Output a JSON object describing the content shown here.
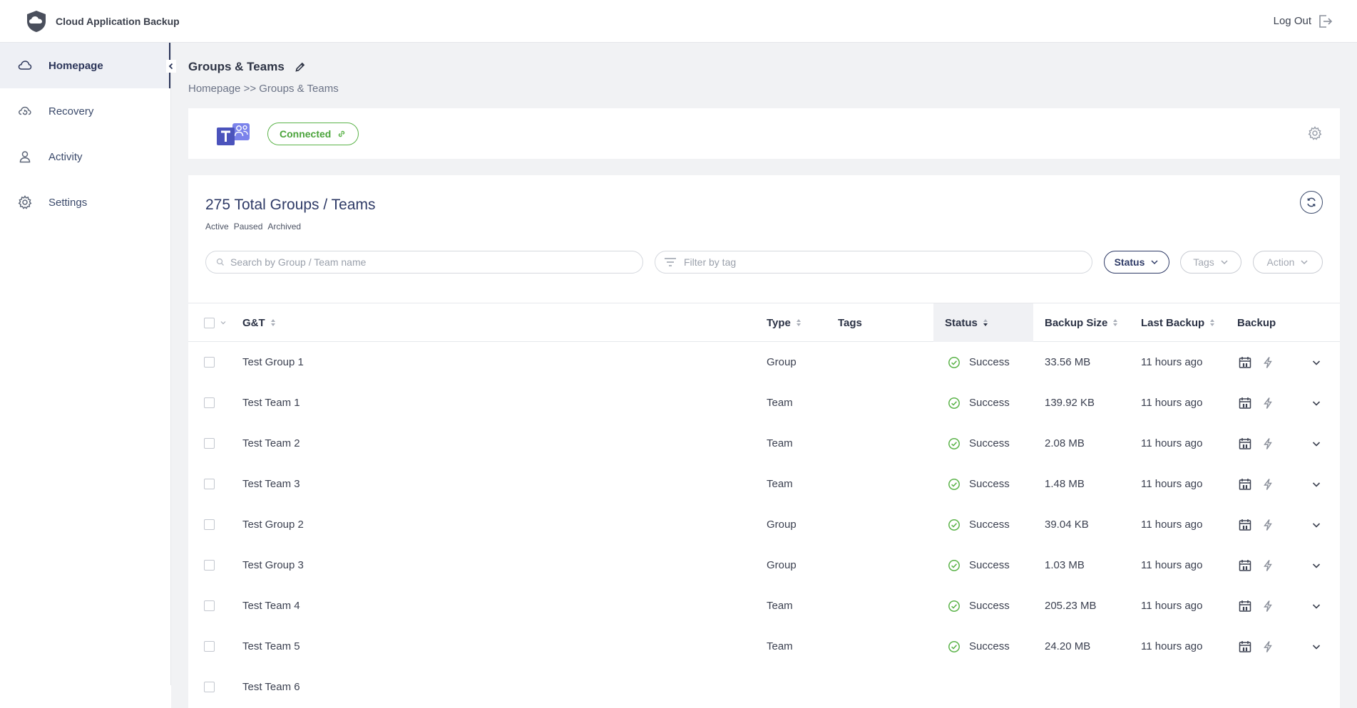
{
  "app": {
    "title": "Cloud Application Backup",
    "logout_label": "Log Out"
  },
  "sidebar": {
    "items": [
      {
        "label": "Homepage",
        "icon": "cloud-icon",
        "active": true
      },
      {
        "label": "Recovery",
        "icon": "recovery-icon",
        "active": false
      },
      {
        "label": "Activity",
        "icon": "user-icon",
        "active": false
      },
      {
        "label": "Settings",
        "icon": "gear-icon",
        "active": false
      }
    ]
  },
  "page": {
    "title": "Groups & Teams",
    "breadcrumb": {
      "home": "Homepage",
      "separator": ">>",
      "current": "Groups & Teams"
    }
  },
  "connection": {
    "status_label": "Connected",
    "service_icon": "microsoft-teams-icon"
  },
  "list": {
    "total_label": "275 Total Groups / Teams",
    "status_filters": [
      "Active",
      "Paused",
      "Archived"
    ],
    "search_placeholder": "Search by Group / Team name",
    "tag_filter_placeholder": "Filter by tag",
    "buttons": {
      "status": "Status",
      "tags": "Tags",
      "action": "Action"
    },
    "columns": {
      "name": "G&T",
      "type": "Type",
      "tags": "Tags",
      "status": "Status",
      "size": "Backup Size",
      "last": "Last Backup",
      "backup": "Backup"
    },
    "rows": [
      {
        "name": "Test Group 1",
        "type": "Group",
        "status": "Success",
        "size": "33.56 MB",
        "last": "11 hours ago"
      },
      {
        "name": "Test Team 1",
        "type": "Team",
        "status": "Success",
        "size": "139.92 KB",
        "last": "11 hours ago"
      },
      {
        "name": "Test Team 2",
        "type": "Team",
        "status": "Success",
        "size": "2.08 MB",
        "last": "11 hours ago"
      },
      {
        "name": "Test Team 3",
        "type": "Team",
        "status": "Success",
        "size": "1.48 MB",
        "last": "11 hours ago"
      },
      {
        "name": "Test Group 2",
        "type": "Group",
        "status": "Success",
        "size": "39.04 KB",
        "last": "11 hours ago"
      },
      {
        "name": "Test Group 3",
        "type": "Group",
        "status": "Success",
        "size": "1.03 MB",
        "last": "11 hours ago"
      },
      {
        "name": "Test Team 4",
        "type": "Team",
        "status": "Success",
        "size": "205.23 MB",
        "last": "11 hours ago"
      },
      {
        "name": "Test Team 5",
        "type": "Team",
        "status": "Success",
        "size": "24.20 MB",
        "last": "11 hours ago"
      },
      {
        "name": "Test Team 6",
        "type": "",
        "status": "",
        "size": "",
        "last": ""
      }
    ]
  },
  "colors": {
    "accent": "#2e3a66",
    "success": "#5bb349",
    "teams": "#5059c9"
  }
}
